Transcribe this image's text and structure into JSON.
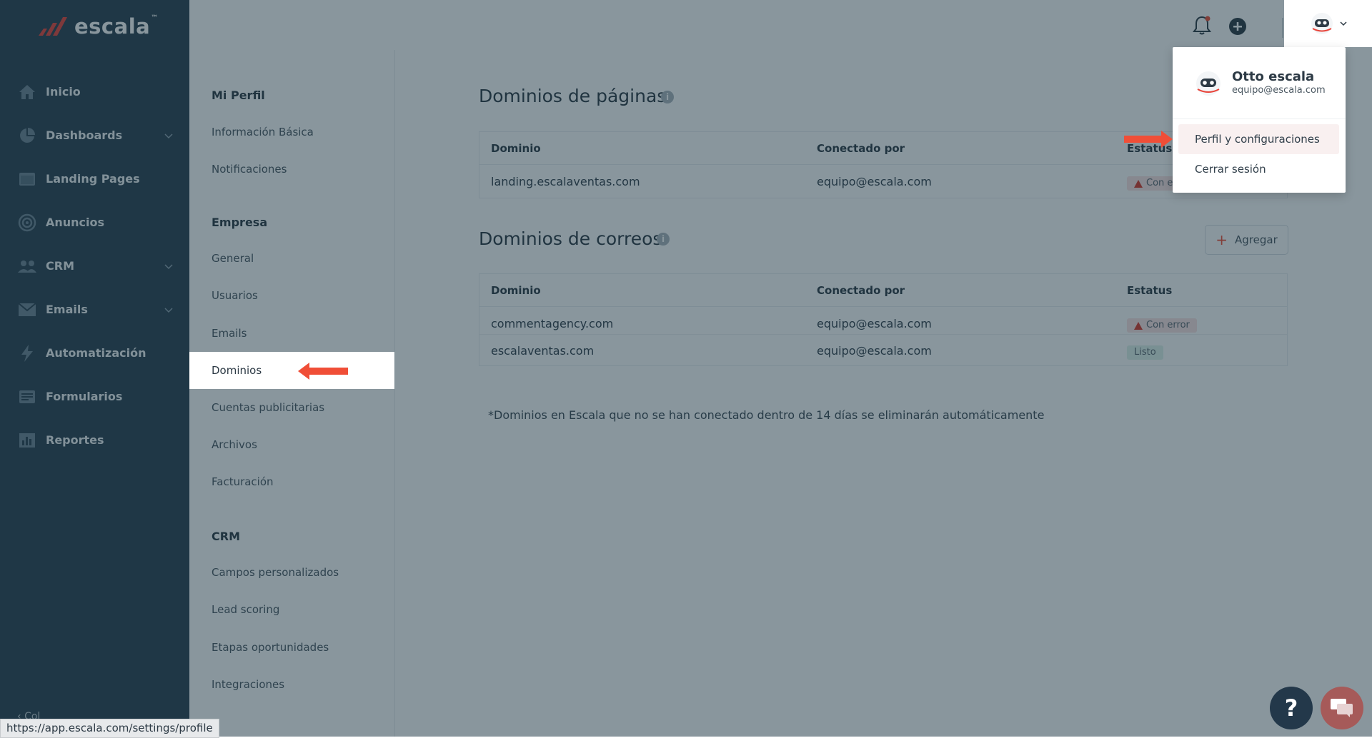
{
  "brand": {
    "logo_text": "escala",
    "tm": "™"
  },
  "sidebar": {
    "items": [
      {
        "label": "Inicio",
        "icon": "home-icon",
        "chevron": false
      },
      {
        "label": "Dashboards",
        "icon": "pie-chart-icon",
        "chevron": true
      },
      {
        "label": "Landing Pages",
        "icon": "browser-window-icon",
        "chevron": false
      },
      {
        "label": "Anuncios",
        "icon": "target-icon",
        "chevron": false
      },
      {
        "label": "CRM",
        "icon": "users-icon",
        "chevron": true
      },
      {
        "label": "Emails",
        "icon": "envelope-icon",
        "chevron": true
      },
      {
        "label": "Automatización",
        "icon": "bolt-icon",
        "chevron": false
      },
      {
        "label": "Formularios",
        "icon": "form-icon",
        "chevron": false
      },
      {
        "label": "Reportes",
        "icon": "bar-chart-icon",
        "chevron": false
      }
    ],
    "collapse_label": "Col"
  },
  "settings": {
    "mi_perfil": {
      "title": "Mi Perfil",
      "links": [
        "Información Básica",
        "Notificaciones"
      ]
    },
    "empresa": {
      "title": "Empresa",
      "links": [
        "General",
        "Usuarios",
        "Emails",
        "Dominios",
        "Cuentas publicitarias",
        "Archivos",
        "Facturación"
      ]
    },
    "crm": {
      "title": "CRM",
      "links": [
        "Campos personalizados",
        "Lead scoring",
        "Etapas oportunidades",
        "Integraciones"
      ]
    },
    "active": "Dominios"
  },
  "main": {
    "pages_section": {
      "title": "Dominios de páginas",
      "headers": [
        "Dominio",
        "Conectado por",
        "Estatus"
      ],
      "rows": [
        {
          "domain": "landing.escalaventas.com",
          "by": "equipo@escala.com",
          "status": "Con error",
          "status_type": "error"
        }
      ]
    },
    "mail_section": {
      "title": "Dominios de correos",
      "add_label": "Agregar",
      "headers": [
        "Dominio",
        "Conectado por",
        "Estatus"
      ],
      "rows": [
        {
          "domain": "commentagency.com",
          "by": "equipo@escala.com",
          "status": "Con error",
          "status_type": "error"
        },
        {
          "domain": "escalaventas.com",
          "by": "equipo@escala.com",
          "status": "Listo",
          "status_type": "ok"
        }
      ]
    },
    "footnote": "*Dominios en Escala que no se han conectado dentro de 14 días se eliminarán automáticamente"
  },
  "user_menu": {
    "name": "Otto escala",
    "email": "equipo@escala.com",
    "items": [
      "Perfil y configuraciones",
      "Cerrar sesión"
    ]
  },
  "status_bar_url": "https://app.escala.com/settings/profile",
  "help_label": "?",
  "colors": {
    "sidebar_bg": "#2b4150",
    "accent_red": "#f04e37",
    "error_badge": "#fbe2e2",
    "ok_badge": "#dff3ea"
  }
}
